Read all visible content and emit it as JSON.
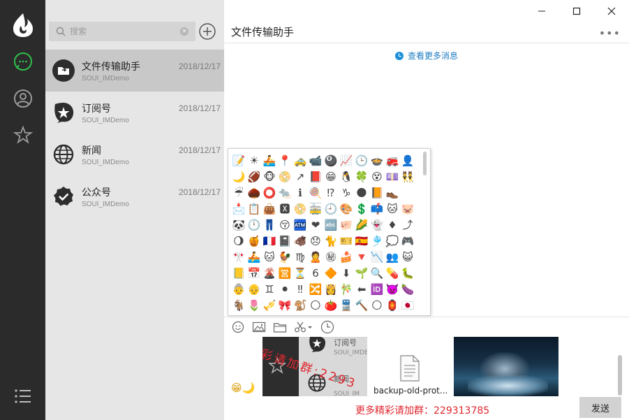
{
  "window": {
    "title": "文件传输助手",
    "controls": [
      "minimize",
      "maximize",
      "close"
    ]
  },
  "rail": {
    "items": [
      {
        "icon": "chat-bubble-icon",
        "active": true
      },
      {
        "icon": "contacts-icon",
        "active": false
      },
      {
        "icon": "star-icon",
        "active": false
      }
    ],
    "menu_icon": "list-menu-icon",
    "accent": "#2fbf4a"
  },
  "search": {
    "placeholder": "搜索"
  },
  "contacts": [
    {
      "name": "文件传输助手",
      "sub": "SOUI_IMDemo",
      "date": "2018/12/17",
      "active": true
    },
    {
      "name": "订阅号",
      "sub": "SOUI_IMDemo",
      "date": "2018/12/17",
      "active": false
    },
    {
      "name": "新闻",
      "sub": "SOUI_IMDemo",
      "date": "2018/12/17",
      "active": false
    },
    {
      "name": "公众号",
      "sub": "SOUI_IMDemo",
      "date": "2018/12/17",
      "active": false
    }
  ],
  "chat": {
    "history_link": "查看更多消息",
    "more": "•••"
  },
  "emoji_panel": {
    "emojis": [
      "📝",
      "☀",
      "🚣",
      "📍",
      "🚕",
      "📹",
      "🎱",
      "📈",
      "🕒",
      "🍲",
      "🚒",
      "👤",
      "🌙",
      "🏈",
      "🐵",
      "📀",
      "↗",
      "📕",
      "😁",
      "🐧",
      "🍀",
      "😵",
      "💷",
      "👯",
      "☔",
      "🌰",
      "⭕",
      "🐀",
      "ℹ",
      "🍭",
      "⁉",
      "♑",
      "🌑",
      "📙",
      "👞",
      "",
      "📩",
      "📋",
      "👜",
      "🆇",
      "📀",
      "🚋",
      "🕘",
      "🎨",
      "💲",
      "📫",
      "🐱",
      "🐷",
      "🐼",
      "🕛",
      "👖",
      "😚",
      "🏧",
      "❤",
      "🔤",
      "🐖",
      "🌽",
      "👻",
      "♦",
      "⤴",
      "🌖",
      "🍯",
      "🇫🇷",
      "📓",
      "🐗",
      "😞",
      "🐈",
      "🎫",
      "🇪🇸",
      "🎐",
      "💭",
      "🎮",
      "🎌",
      "🚣",
      "🐱",
      "🐓",
      "♍",
      "🙎",
      "㊙",
      "🍰",
      "🔻",
      "📉",
      "👥",
      "😺",
      "📒",
      "📅",
      "🌋",
      "🈺",
      "⏳",
      "6",
      "🔶",
      "⬇",
      "🌱",
      "🔍",
      "💊",
      "🐛",
      "👵",
      "👴",
      "♊",
      "⚫",
      "‼",
      "🔀",
      "👸",
      "🎋",
      "⬅",
      "🆔",
      "👿",
      "🍆",
      "🐐",
      "🌷",
      "🎺",
      "🎀",
      "🐒",
      "🌕",
      "🍅",
      "🚆",
      "🔨",
      "🌕",
      "🏮",
      "🇯🇵"
    ]
  },
  "toolbar": {
    "tools": [
      "smiley-icon",
      "image-icon",
      "folder-icon",
      "scissors-icon",
      "clock-icon"
    ]
  },
  "composer": {
    "inline_emojis": "😁🌙",
    "thumb_lines": [
      "订阅号",
      "SOUI_IMDE",
      "新闻",
      "SOUI_IM"
    ],
    "watermark": "彩请加群:2293",
    "file_name": "backup-old-prot...",
    "group_note": "更多精彩请加群：229313785",
    "send_label": "发送"
  }
}
